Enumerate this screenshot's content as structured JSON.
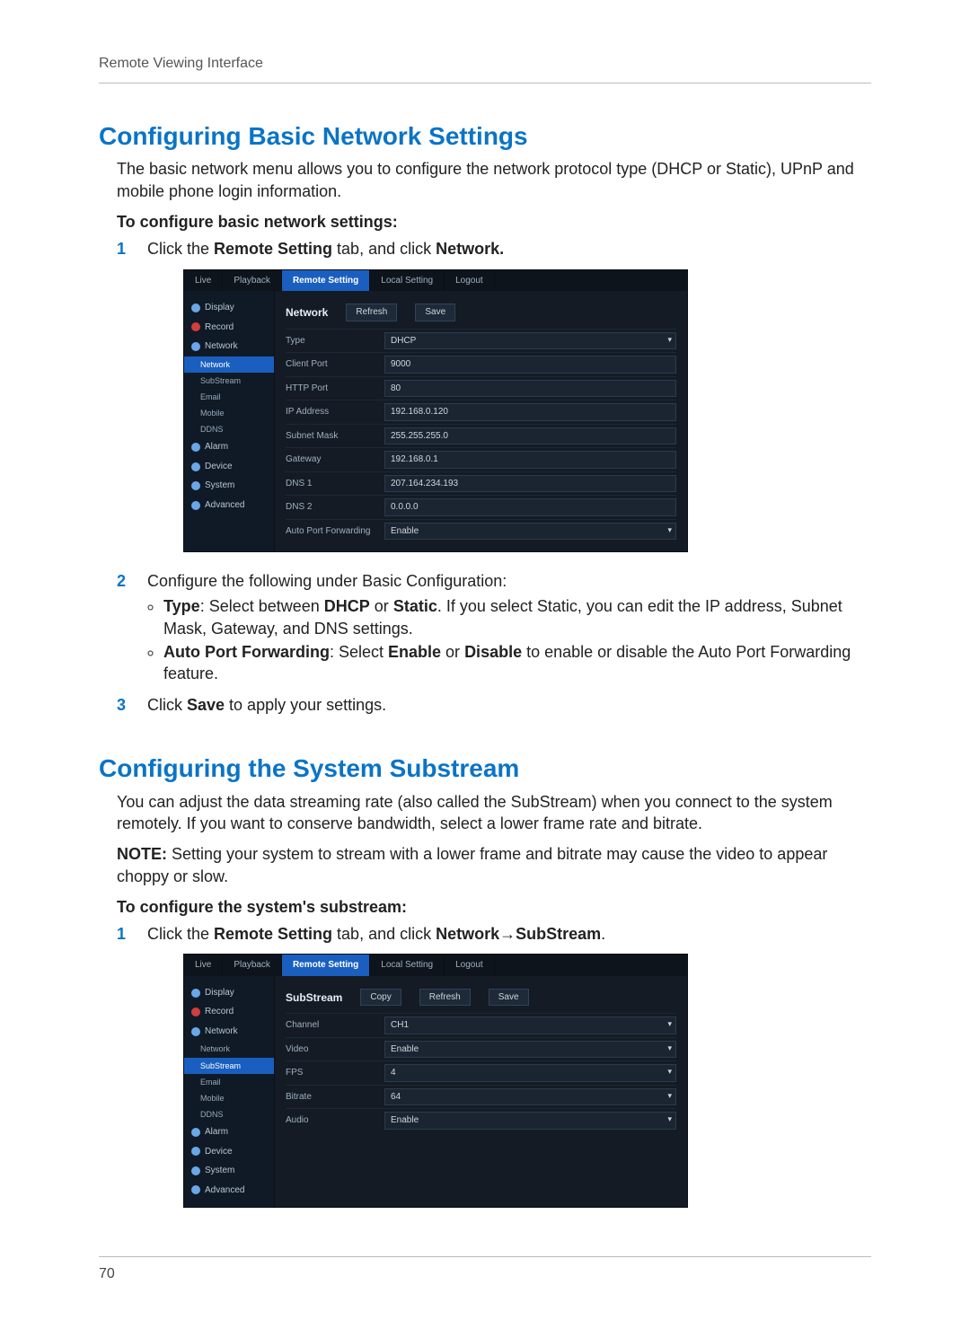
{
  "runningHead": "Remote Viewing Interface",
  "pageNumber": "70",
  "section1": {
    "title": "Configuring Basic Network Settings",
    "intro": "The basic network menu allows you to configure the network protocol type (DHCP or Static), UPnP and mobile phone login information.",
    "subhead": "To configure basic network settings:",
    "step1_pre": "Click the ",
    "step1_bold1": "Remote Setting",
    "step1_mid": " tab, and click ",
    "step1_bold2": "Network.",
    "shot": {
      "tabs": [
        "Live",
        "Playback",
        "Remote Setting",
        "Local Setting",
        "Logout"
      ],
      "activeTab": 2,
      "side": [
        "Display",
        "Record",
        "Network"
      ],
      "subs": [
        "Network",
        "SubStream",
        "Email",
        "Mobile",
        "DDNS"
      ],
      "activeSub": 0,
      "side2": [
        "Alarm",
        "Device",
        "System",
        "Advanced"
      ],
      "panelTitle": "Network",
      "buttons": [
        "Refresh",
        "Save"
      ],
      "rows": [
        {
          "lab": "Type",
          "val": "DHCP",
          "sel": true
        },
        {
          "lab": "Client Port",
          "val": "9000"
        },
        {
          "lab": "HTTP Port",
          "val": "80"
        },
        {
          "lab": "IP Address",
          "val": "192.168.0.120"
        },
        {
          "lab": "Subnet Mask",
          "val": "255.255.255.0"
        },
        {
          "lab": "Gateway",
          "val": "192.168.0.1"
        },
        {
          "lab": "DNS 1",
          "val": "207.164.234.193"
        },
        {
          "lab": "DNS 2",
          "val": "0.0.0.0"
        },
        {
          "lab": "Auto Port Forwarding",
          "val": "Enable",
          "sel": true
        }
      ]
    },
    "step2_lead": "Configure the following under Basic Configuration:",
    "bullet1_pre": "",
    "bullet1_b1": "Type",
    "bullet1_mid1": ": Select between ",
    "bullet1_b2": "DHCP",
    "bullet1_mid2": " or ",
    "bullet1_b3": "Static",
    "bullet1_tail": ". If you select Static, you can edit the IP address, Subnet Mask, Gateway, and DNS settings.",
    "bullet2_b1": "Auto Port Forwarding",
    "bullet2_mid1": ": Select ",
    "bullet2_b2": "Enable",
    "bullet2_mid2": " or ",
    "bullet2_b3": "Disable",
    "bullet2_tail": " to enable or disable the Auto Port Forwarding feature.",
    "step3_pre": "Click ",
    "step3_bold": "Save",
    "step3_tail": " to apply your settings."
  },
  "section2": {
    "title": "Configuring the System Substream",
    "intro": "You can adjust the data streaming rate (also called the SubStream) when you connect to the system remotely. If you want to conserve bandwidth, select a lower frame rate and bitrate.",
    "note_label": "NOTE:",
    "note_text": " Setting your system to stream with a lower frame and bitrate may cause the video to appear choppy or slow.",
    "subhead": "To configure the system's substream:",
    "step1_pre": "Click the ",
    "step1_bold1": "Remote Setting",
    "step1_mid": " tab, and click ",
    "step1_bold2": "Network→SubStream",
    "step1_tail": ".",
    "shot": {
      "tabs": [
        "Live",
        "Playback",
        "Remote Setting",
        "Local Setting",
        "Logout"
      ],
      "activeTab": 2,
      "side": [
        "Display",
        "Record",
        "Network"
      ],
      "subs": [
        "Network",
        "SubStream",
        "Email",
        "Mobile",
        "DDNS"
      ],
      "activeSub": 1,
      "side2": [
        "Alarm",
        "Device",
        "System",
        "Advanced"
      ],
      "panelTitle": "SubStream",
      "buttons": [
        "Copy",
        "Refresh",
        "Save"
      ],
      "rows": [
        {
          "lab": "Channel",
          "val": "CH1",
          "sel": true
        },
        {
          "lab": "Video",
          "val": "Enable",
          "sel": true
        },
        {
          "lab": "FPS",
          "val": "4",
          "sel": true
        },
        {
          "lab": "Bitrate",
          "val": "64",
          "sel": true
        },
        {
          "lab": "Audio",
          "val": "Enable",
          "sel": true
        }
      ]
    }
  }
}
